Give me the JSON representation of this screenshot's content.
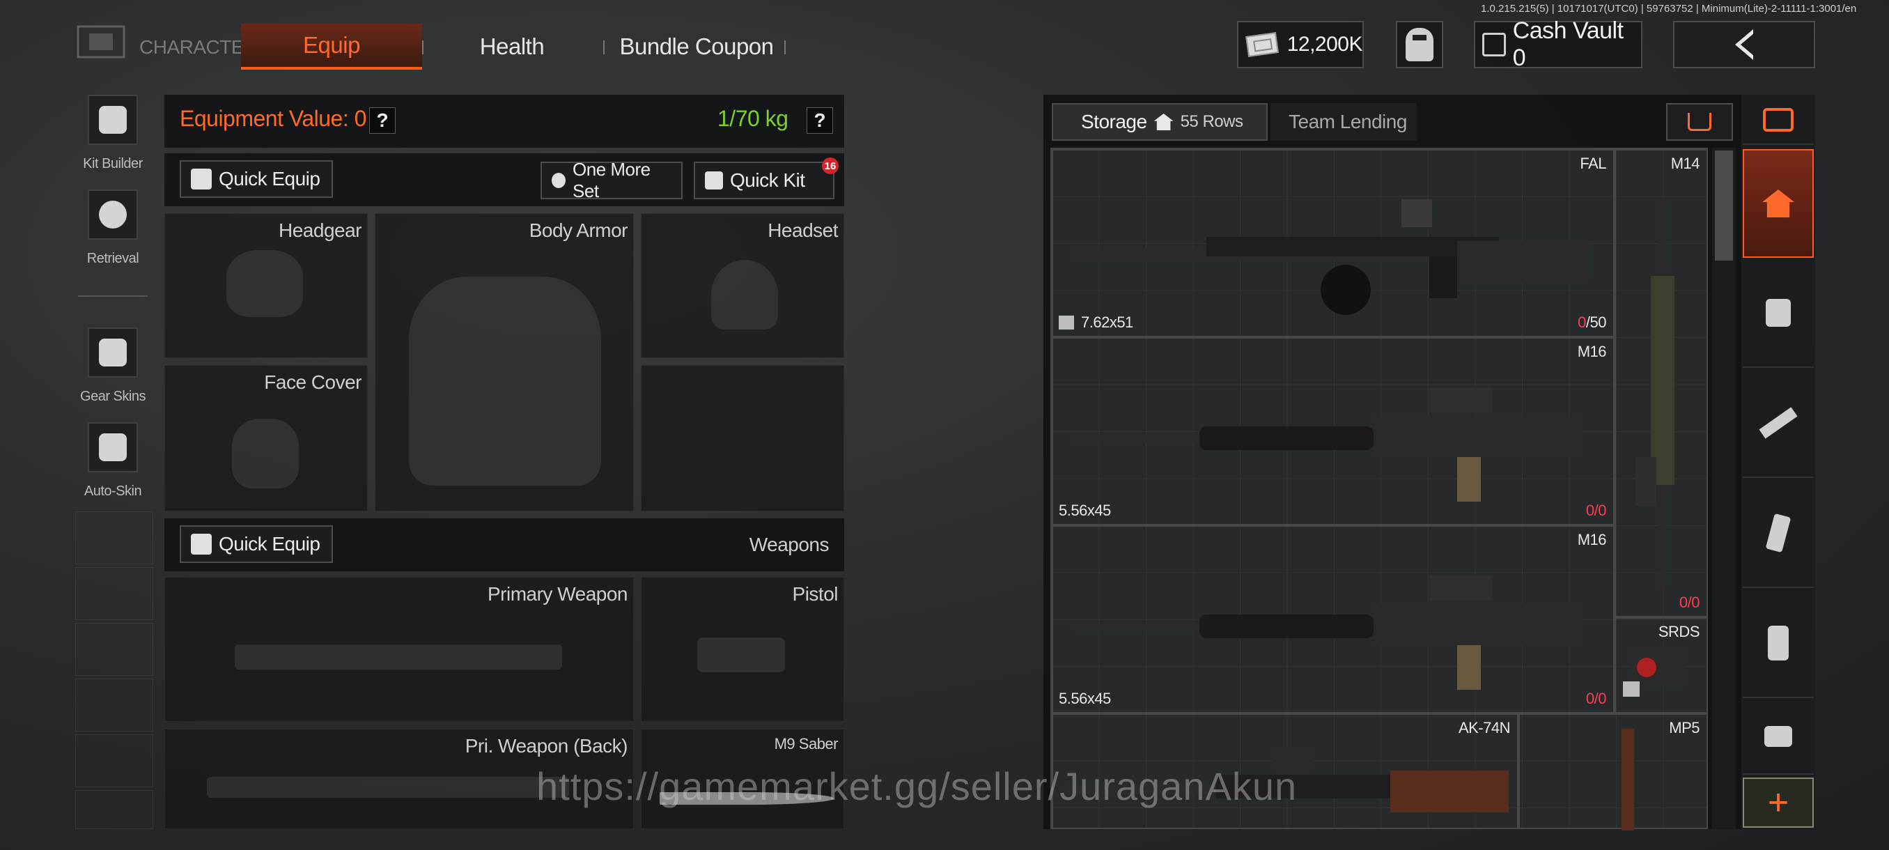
{
  "version": "1.0.215.215(5) | 10171017(UTC0) | 59763752 | Minimum(Lite)-2-11111-1:3001/en",
  "nav": {
    "section_label": "CHARACTER",
    "tabs": [
      {
        "label": "Equip",
        "active": true
      },
      {
        "label": "Health",
        "active": false
      },
      {
        "label": "Bundle Coupon",
        "active": false
      }
    ]
  },
  "topbar": {
    "money": "12,200K",
    "cash_vault": "Cash Vault 0"
  },
  "tools": [
    {
      "label": "Kit Builder",
      "icon": "kit-builder-icon"
    },
    {
      "label": "Retrieval",
      "icon": "retrieval-icon"
    },
    {
      "label": "Gear Skins",
      "icon": "gear-skins-icon"
    },
    {
      "label": "Auto-Skin",
      "icon": "auto-skin-icon"
    }
  ],
  "equipment": {
    "value_label": "Equipment Value: 0",
    "weight": "1/70 kg",
    "help": "?",
    "quick_equip": "Quick Equip",
    "one_more_set": "One More Set",
    "quick_kit": "Quick Kit",
    "quick_kit_badge": "16",
    "slots": {
      "headgear": "Headgear",
      "body_armor": "Body Armor",
      "headset": "Headset",
      "face_cover": "Face Cover"
    },
    "weapons_header": "Weapons",
    "weapons_quick_equip": "Quick Equip",
    "weapon_slots": {
      "primary": "Primary Weapon",
      "pistol": "Pistol",
      "primary_back": "Pri. Weapon (Back)",
      "melee": "M9 Saber"
    }
  },
  "storage": {
    "tab_storage": "Storage",
    "rows": "55 Rows",
    "tab_lending": "Team Lending",
    "items": [
      {
        "name": "FAL",
        "ammo": "7.62x51",
        "count_loaded": "0",
        "count_sep": "/50"
      },
      {
        "name": "M16",
        "ammo": "5.56x45",
        "count_loaded": "0",
        "count_sep": "/0"
      },
      {
        "name": "M16",
        "ammo": "5.56x45",
        "count_loaded": "0",
        "count_sep": "/0"
      },
      {
        "name": "M14",
        "ammo": "",
        "count_loaded": "0",
        "count_sep": "/0"
      },
      {
        "name": "SRDS",
        "ammo": "",
        "count_loaded": "",
        "count_sep": ""
      },
      {
        "name": "AK-74N",
        "ammo": "",
        "count_loaded": "",
        "count_sep": ""
      },
      {
        "name": "MP5",
        "ammo": "",
        "count_loaded": "",
        "count_sep": ""
      }
    ]
  },
  "categories": [
    "home-icon",
    "armor-icon",
    "rifle-icon",
    "magazine-icon",
    "grenade-icon",
    "attachment-icon"
  ],
  "add_button": "+",
  "watermark": "https://gamemarket.gg/seller/JuraganAkun",
  "colors": {
    "accent": "#ff6a2a",
    "weight_ok": "#7fd12a",
    "ammo_empty": "#ff3b4e"
  }
}
